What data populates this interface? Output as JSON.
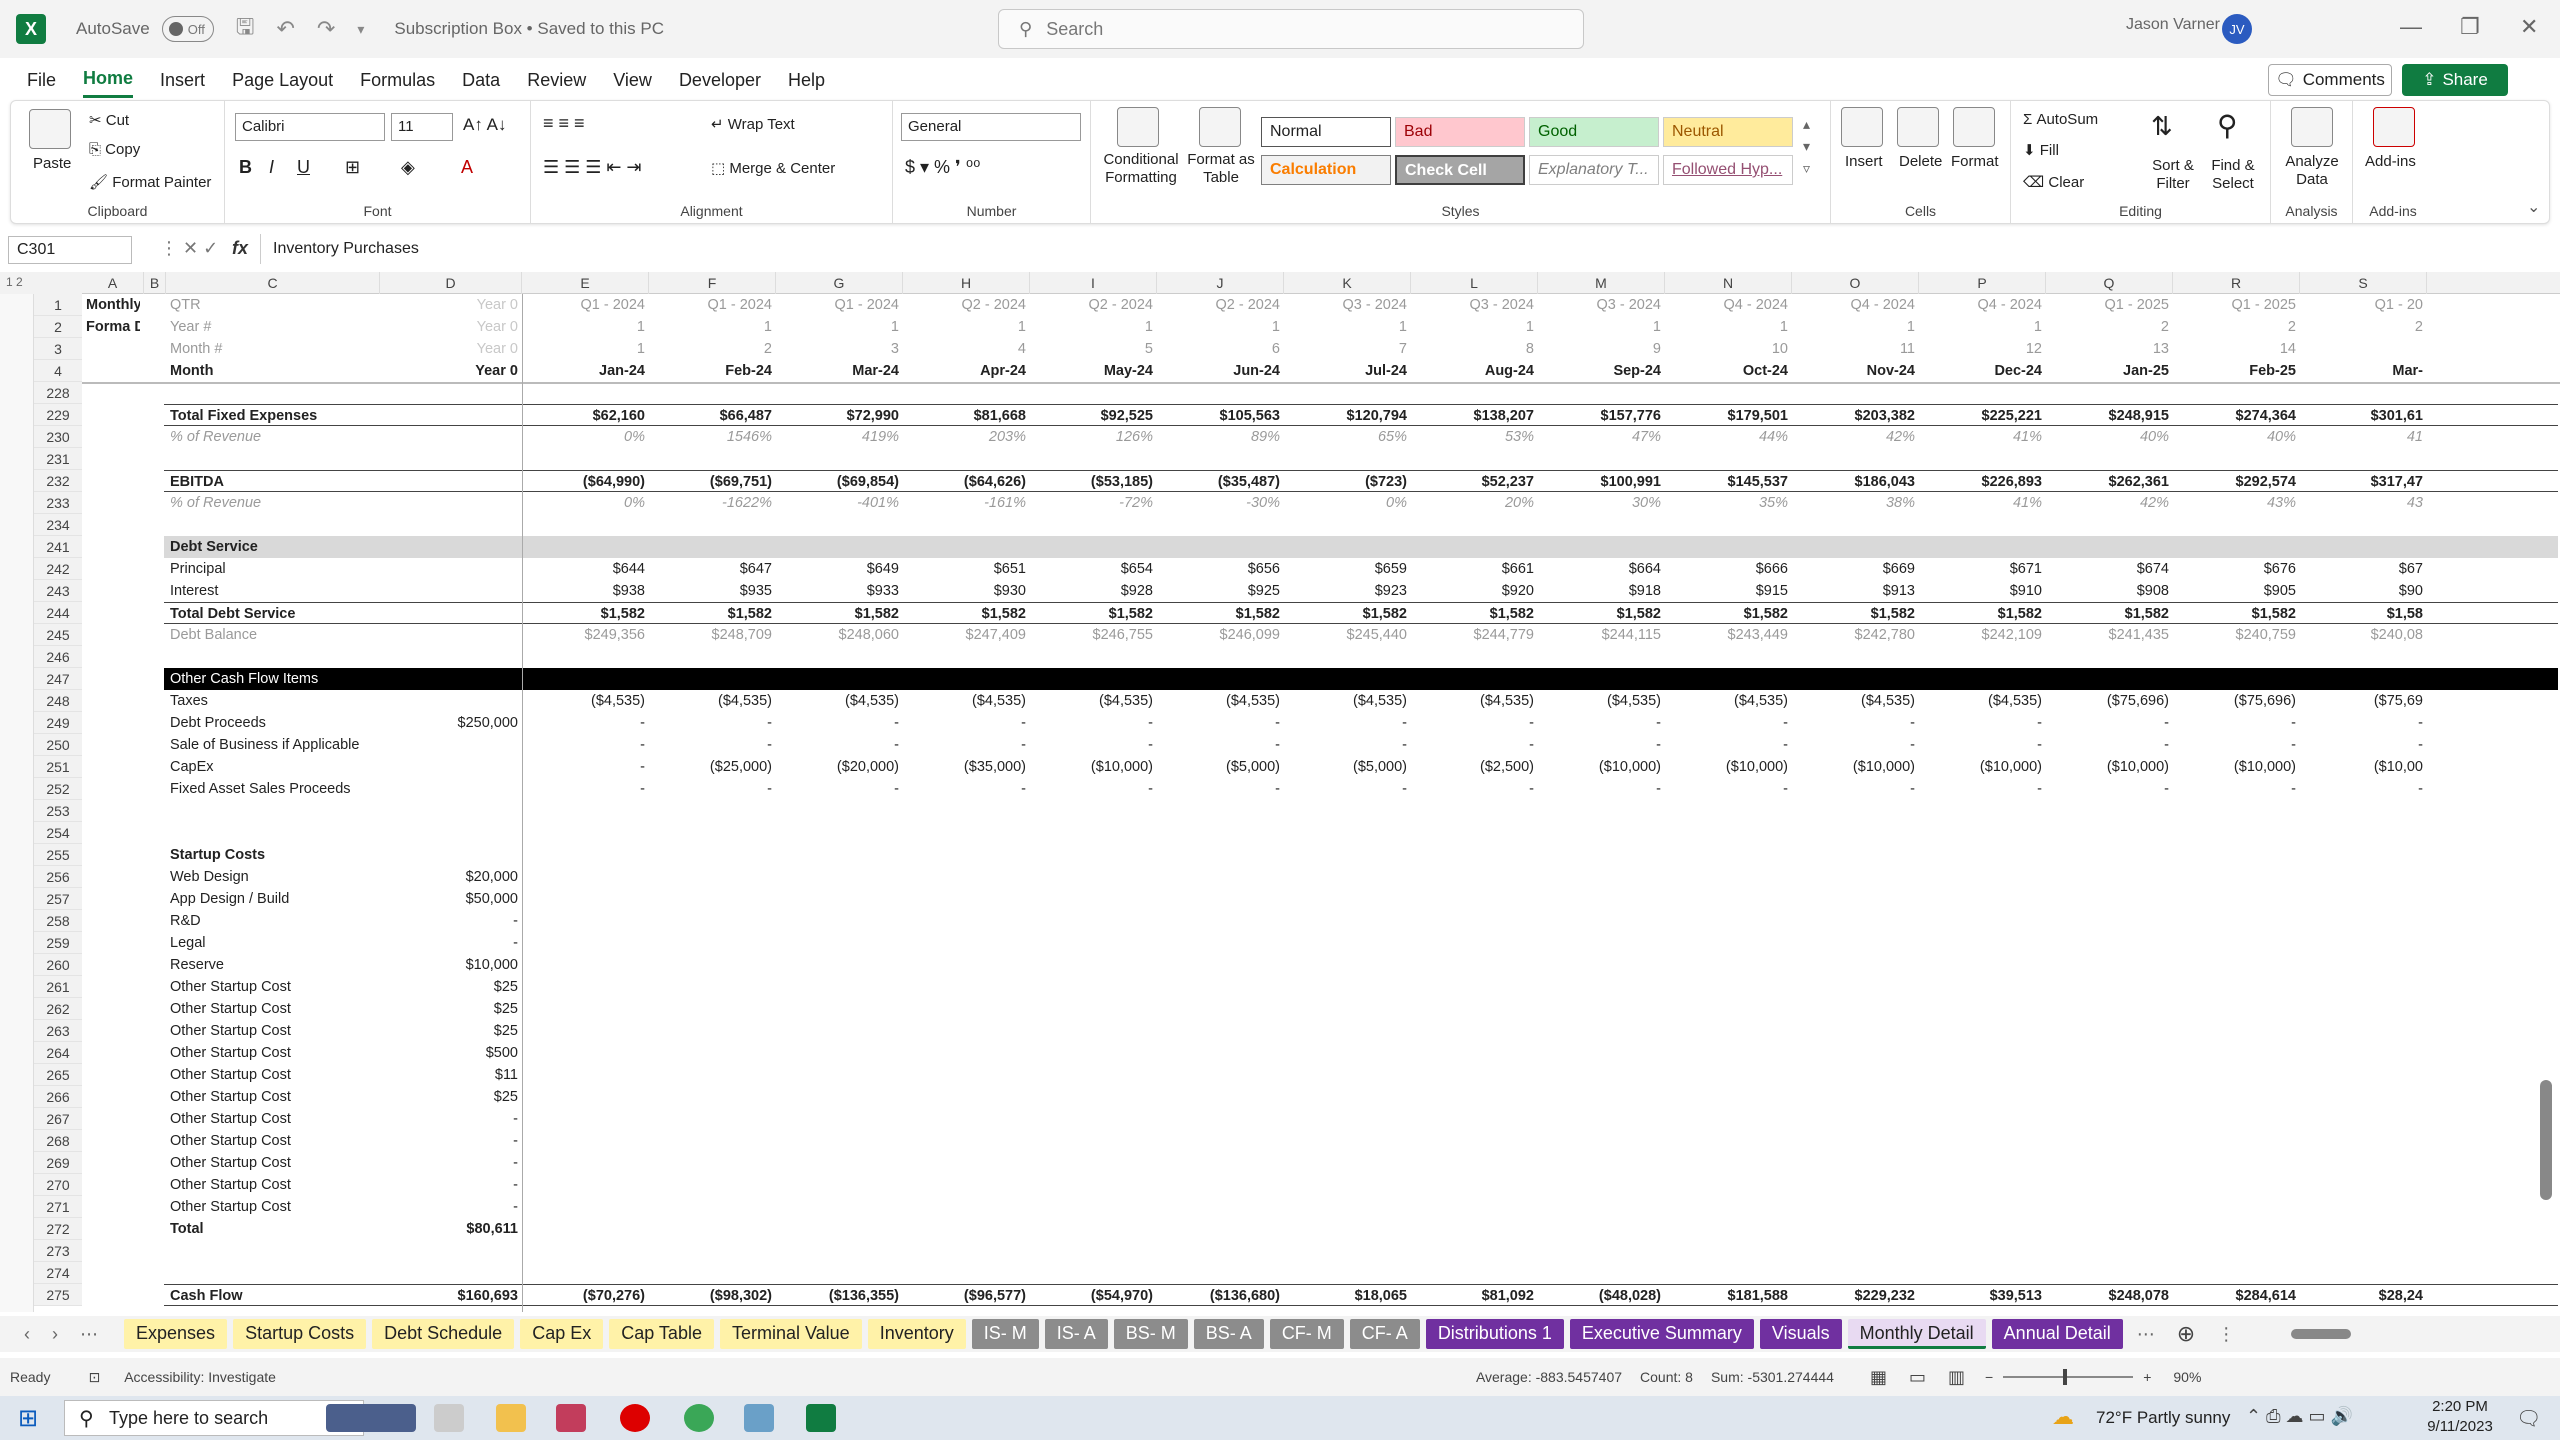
{
  "titlebar": {
    "autosave": "AutoSave",
    "toggle": "Off",
    "doc": "Subscription Box • Saved to this PC",
    "search": "Search",
    "user": "Jason Varner",
    "initials": "JV"
  },
  "menu": [
    "File",
    "Home",
    "Insert",
    "Page Layout",
    "Formulas",
    "Data",
    "Review",
    "View",
    "Developer",
    "Help"
  ],
  "menu_buttons": {
    "comments": "Comments",
    "share": "Share"
  },
  "ribbon": {
    "clipboard": {
      "paste": "Paste",
      "cut": "Cut",
      "copy": "Copy",
      "format_painter": "Format Painter",
      "label": "Clipboard"
    },
    "font": {
      "name": "Calibri",
      "size": "11",
      "label": "Font"
    },
    "alignment": {
      "wrap": "Wrap Text",
      "merge": "Merge & Center",
      "label": "Alignment"
    },
    "number": {
      "format": "General",
      "label": "Number"
    },
    "styles": {
      "cond": "Conditional Formatting",
      "table": "Format as Table",
      "normal": "Normal",
      "bad": "Bad",
      "good": "Good",
      "neutral": "Neutral",
      "calculation": "Calculation",
      "check": "Check Cell",
      "explanatory": "Explanatory T...",
      "followed": "Followed Hyp...",
      "label": "Styles"
    },
    "cells": {
      "insert": "Insert",
      "delete": "Delete",
      "format": "Format",
      "label": "Cells"
    },
    "editing": {
      "autosum": "AutoSum",
      "fill": "Fill",
      "clear": "Clear",
      "sort": "Sort & Filter",
      "find": "Find & Select",
      "label": "Editing"
    },
    "analysis": {
      "analyze": "Analyze Data",
      "label": "Analysis"
    },
    "addins": {
      "addins": "Add-ins",
      "label": "Add-ins"
    }
  },
  "formula": {
    "cell": "C301",
    "fx": "fx",
    "content": "Inventory Purchases"
  },
  "columns": [
    "A",
    "B",
    "C",
    "D",
    "E",
    "F",
    "G",
    "H",
    "I",
    "J",
    "K",
    "L",
    "M",
    "N",
    "O",
    "P",
    "Q",
    "R",
    "S"
  ],
  "rows": [
    {
      "n": "1",
      "a": "Monthly Pro-",
      "c": "QTR",
      "d": "Year 0",
      "v": [
        "Q1 - 2024",
        "Q1 - 2024",
        "Q1 - 2024",
        "Q2 - 2024",
        "Q2 - 2024",
        "Q2 - 2024",
        "Q3 - 2024",
        "Q3 - 2024",
        "Q3 - 2024",
        "Q4 - 2024",
        "Q4 - 2024",
        "Q4 - 2024",
        "Q1 - 2025",
        "Q1 - 2025",
        "Q1 - 20"
      ]
    },
    {
      "n": "2",
      "a": "Forma Detail",
      "c": "Year #",
      "d": "Year 0",
      "v": [
        "1",
        "1",
        "1",
        "1",
        "1",
        "1",
        "1",
        "1",
        "1",
        "1",
        "1",
        "1",
        "2",
        "2",
        "2"
      ]
    },
    {
      "n": "3",
      "a": "",
      "c": "Month #",
      "d": "Year 0",
      "v": [
        "1",
        "2",
        "3",
        "4",
        "5",
        "6",
        "7",
        "8",
        "9",
        "10",
        "11",
        "12",
        "13",
        "14",
        ""
      ]
    },
    {
      "n": "4",
      "a": "",
      "c": "Month",
      "d": "Year 0",
      "v": [
        "Jan-24",
        "Feb-24",
        "Mar-24",
        "Apr-24",
        "May-24",
        "Jun-24",
        "Jul-24",
        "Aug-24",
        "Sep-24",
        "Oct-24",
        "Nov-24",
        "Dec-24",
        "Jan-25",
        "Feb-25",
        "Mar-"
      ]
    },
    {
      "n": "228",
      "a": "",
      "c": "",
      "d": "",
      "v": []
    },
    {
      "n": "229",
      "a": "",
      "c": "Total Fixed Expenses",
      "d": "",
      "v": [
        "$62,160",
        "$66,487",
        "$72,990",
        "$81,668",
        "$92,525",
        "$105,563",
        "$120,794",
        "$138,207",
        "$157,776",
        "$179,501",
        "$203,382",
        "$225,221",
        "$248,915",
        "$274,364",
        "$301,61"
      ]
    },
    {
      "n": "230",
      "a": "",
      "c": "% of Revenue",
      "d": "",
      "v": [
        "0%",
        "1546%",
        "419%",
        "203%",
        "126%",
        "89%",
        "65%",
        "53%",
        "47%",
        "44%",
        "42%",
        "41%",
        "40%",
        "40%",
        "41"
      ]
    },
    {
      "n": "231",
      "a": "",
      "c": "",
      "d": "",
      "v": []
    },
    {
      "n": "232",
      "a": "",
      "c": "EBITDA",
      "d": "",
      "v": [
        "($64,990)",
        "($69,751)",
        "($69,854)",
        "($64,626)",
        "($53,185)",
        "($35,487)",
        "($723)",
        "$52,237",
        "$100,991",
        "$145,537",
        "$186,043",
        "$226,893",
        "$262,361",
        "$292,574",
        "$317,47"
      ]
    },
    {
      "n": "233",
      "a": "",
      "c": "% of Revenue",
      "d": "",
      "v": [
        "0%",
        "-1622%",
        "-401%",
        "-161%",
        "-72%",
        "-30%",
        "0%",
        "20%",
        "30%",
        "35%",
        "38%",
        "41%",
        "42%",
        "43%",
        "43"
      ]
    },
    {
      "n": "234",
      "a": "",
      "c": "",
      "d": "",
      "v": []
    },
    {
      "n": "241",
      "a": "",
      "c": "Debt Service",
      "d": "",
      "v": []
    },
    {
      "n": "242",
      "a": "",
      "c": "Principal",
      "d": "",
      "v": [
        "$644",
        "$647",
        "$649",
        "$651",
        "$654",
        "$656",
        "$659",
        "$661",
        "$664",
        "$666",
        "$669",
        "$671",
        "$674",
        "$676",
        "$67"
      ]
    },
    {
      "n": "243",
      "a": "",
      "c": "Interest",
      "d": "",
      "v": [
        "$938",
        "$935",
        "$933",
        "$930",
        "$928",
        "$925",
        "$923",
        "$920",
        "$918",
        "$915",
        "$913",
        "$910",
        "$908",
        "$905",
        "$90"
      ]
    },
    {
      "n": "244",
      "a": "",
      "c": "Total Debt Service",
      "d": "",
      "v": [
        "$1,582",
        "$1,582",
        "$1,582",
        "$1,582",
        "$1,582",
        "$1,582",
        "$1,582",
        "$1,582",
        "$1,582",
        "$1,582",
        "$1,582",
        "$1,582",
        "$1,582",
        "$1,582",
        "$1,58"
      ]
    },
    {
      "n": "245",
      "a": "",
      "c": "Debt Balance",
      "d": "",
      "v": [
        "$249,356",
        "$248,709",
        "$248,060",
        "$247,409",
        "$246,755",
        "$246,099",
        "$245,440",
        "$244,779",
        "$244,115",
        "$243,449",
        "$242,780",
        "$242,109",
        "$241,435",
        "$240,759",
        "$240,08"
      ]
    },
    {
      "n": "246",
      "a": "",
      "c": "",
      "d": "",
      "v": []
    },
    {
      "n": "247",
      "a": "",
      "c": "Other Cash Flow Items",
      "d": "",
      "v": []
    },
    {
      "n": "248",
      "a": "",
      "c": "Taxes",
      "d": "",
      "v": [
        "($4,535)",
        "($4,535)",
        "($4,535)",
        "($4,535)",
        "($4,535)",
        "($4,535)",
        "($4,535)",
        "($4,535)",
        "($4,535)",
        "($4,535)",
        "($4,535)",
        "($4,535)",
        "($75,696)",
        "($75,696)",
        "($75,69"
      ]
    },
    {
      "n": "249",
      "a": "",
      "c": "Debt Proceeds",
      "d": "$250,000",
      "v": [
        "-",
        "-",
        "-",
        "-",
        "-",
        "-",
        "-",
        "-",
        "-",
        "-",
        "-",
        "-",
        "-",
        "-",
        "-"
      ]
    },
    {
      "n": "250",
      "a": "",
      "c": "Sale of Business if Applicable",
      "d": "",
      "v": [
        "-",
        "-",
        "-",
        "-",
        "-",
        "-",
        "-",
        "-",
        "-",
        "-",
        "-",
        "-",
        "-",
        "-",
        "-"
      ]
    },
    {
      "n": "251",
      "a": "",
      "c": "CapEx",
      "d": "",
      "v": [
        "-",
        "($25,000)",
        "($20,000)",
        "($35,000)",
        "($10,000)",
        "($5,000)",
        "($5,000)",
        "($2,500)",
        "($10,000)",
        "($10,000)",
        "($10,000)",
        "($10,000)",
        "($10,000)",
        "($10,000)",
        "($10,00"
      ]
    },
    {
      "n": "252",
      "a": "",
      "c": "Fixed Asset Sales Proceeds",
      "d": "",
      "v": [
        "-",
        "-",
        "-",
        "-",
        "-",
        "-",
        "-",
        "-",
        "-",
        "-",
        "-",
        "-",
        "-",
        "-",
        "-"
      ]
    },
    {
      "n": "253",
      "a": "",
      "c": "",
      "d": "",
      "v": []
    },
    {
      "n": "254",
      "a": "",
      "c": "",
      "d": "",
      "v": []
    },
    {
      "n": "255",
      "a": "",
      "c": "Startup Costs",
      "d": "",
      "v": []
    },
    {
      "n": "256",
      "a": "",
      "c": "Web Design",
      "d": "$20,000",
      "v": []
    },
    {
      "n": "257",
      "a": "",
      "c": "App Design / Build",
      "d": "$50,000",
      "v": []
    },
    {
      "n": "258",
      "a": "",
      "c": "R&D",
      "d": "-",
      "v": []
    },
    {
      "n": "259",
      "a": "",
      "c": "Legal",
      "d": "-",
      "v": []
    },
    {
      "n": "260",
      "a": "",
      "c": "Reserve",
      "d": "$10,000",
      "v": []
    },
    {
      "n": "261",
      "a": "",
      "c": "Other Startup Cost",
      "d": "$25",
      "v": []
    },
    {
      "n": "262",
      "a": "",
      "c": "Other Startup Cost",
      "d": "$25",
      "v": []
    },
    {
      "n": "263",
      "a": "",
      "c": "Other Startup Cost",
      "d": "$25",
      "v": []
    },
    {
      "n": "264",
      "a": "",
      "c": "Other Startup Cost",
      "d": "$500",
      "v": []
    },
    {
      "n": "265",
      "a": "",
      "c": "Other Startup Cost",
      "d": "$11",
      "v": []
    },
    {
      "n": "266",
      "a": "",
      "c": "Other Startup Cost",
      "d": "$25",
      "v": []
    },
    {
      "n": "267",
      "a": "",
      "c": "Other Startup Cost",
      "d": "-",
      "v": []
    },
    {
      "n": "268",
      "a": "",
      "c": "Other Startup Cost",
      "d": "-",
      "v": []
    },
    {
      "n": "269",
      "a": "",
      "c": "Other Startup Cost",
      "d": "-",
      "v": []
    },
    {
      "n": "270",
      "a": "",
      "c": "Other Startup Cost",
      "d": "-",
      "v": []
    },
    {
      "n": "271",
      "a": "",
      "c": "Other Startup Cost",
      "d": "-",
      "v": []
    },
    {
      "n": "272",
      "a": "",
      "c": "Total",
      "d": "$80,611",
      "v": []
    },
    {
      "n": "273",
      "a": "",
      "c": "",
      "d": "",
      "v": []
    },
    {
      "n": "274",
      "a": "",
      "c": "",
      "d": "",
      "v": []
    },
    {
      "n": "275",
      "a": "",
      "c": "Cash Flow",
      "d": "$160,693",
      "v": [
        "($70,276)",
        "($98,302)",
        "($136,355)",
        "($96,577)",
        "($54,970)",
        "($136,680)",
        "$18,065",
        "$81,092",
        "($48,028)",
        "$181,588",
        "$229,232",
        "$39,513",
        "$248,078",
        "$284,614",
        "$28,24"
      ]
    }
  ],
  "sheet_tabs": [
    {
      "label": "Expenses",
      "color": "#fff2a8",
      "fg": "#222"
    },
    {
      "label": "Startup Costs",
      "color": "#fff2a8",
      "fg": "#222"
    },
    {
      "label": "Debt Schedule",
      "color": "#fff2a8",
      "fg": "#222"
    },
    {
      "label": "Cap Ex",
      "color": "#fff2a8",
      "fg": "#222"
    },
    {
      "label": "Cap Table",
      "color": "#fff2a8",
      "fg": "#222"
    },
    {
      "label": "Terminal Value",
      "color": "#fff2a8",
      "fg": "#222"
    },
    {
      "label": "Inventory",
      "color": "#fff2a8",
      "fg": "#222"
    },
    {
      "label": "IS- M",
      "color": "#8c8c8c",
      "fg": "#fff"
    },
    {
      "label": "IS- A",
      "color": "#8c8c8c",
      "fg": "#fff"
    },
    {
      "label": "BS- M",
      "color": "#8c8c8c",
      "fg": "#fff"
    },
    {
      "label": "BS- A",
      "color": "#8c8c8c",
      "fg": "#fff"
    },
    {
      "label": "CF- M",
      "color": "#8c8c8c",
      "fg": "#fff"
    },
    {
      "label": "CF- A",
      "color": "#8c8c8c",
      "fg": "#fff"
    },
    {
      "label": "Distributions 1",
      "color": "#7030a0",
      "fg": "#fff"
    },
    {
      "label": "Executive Summary",
      "color": "#7030a0",
      "fg": "#fff"
    },
    {
      "label": "Visuals",
      "color": "#7030a0",
      "fg": "#fff"
    },
    {
      "label": "Monthly Detail",
      "color": "#e8daf2",
      "fg": "#222"
    },
    {
      "label": "Annual Detail",
      "color": "#7030a0",
      "fg": "#fff"
    }
  ],
  "status": {
    "ready": "Ready",
    "accessibility": "Accessibility: Investigate",
    "average": "Average: -883.5457407",
    "count": "Count: 8",
    "sum": "Sum: -5301.274444",
    "zoom": "90%"
  },
  "taskbar": {
    "search": "Type here to search",
    "weather": "72°F  Partly sunny",
    "time": "2:20 PM",
    "date": "9/11/2023"
  },
  "colors": {
    "excel_green": "#107c41",
    "purple_tab": "#7030a0",
    "header_black": "#000000"
  }
}
